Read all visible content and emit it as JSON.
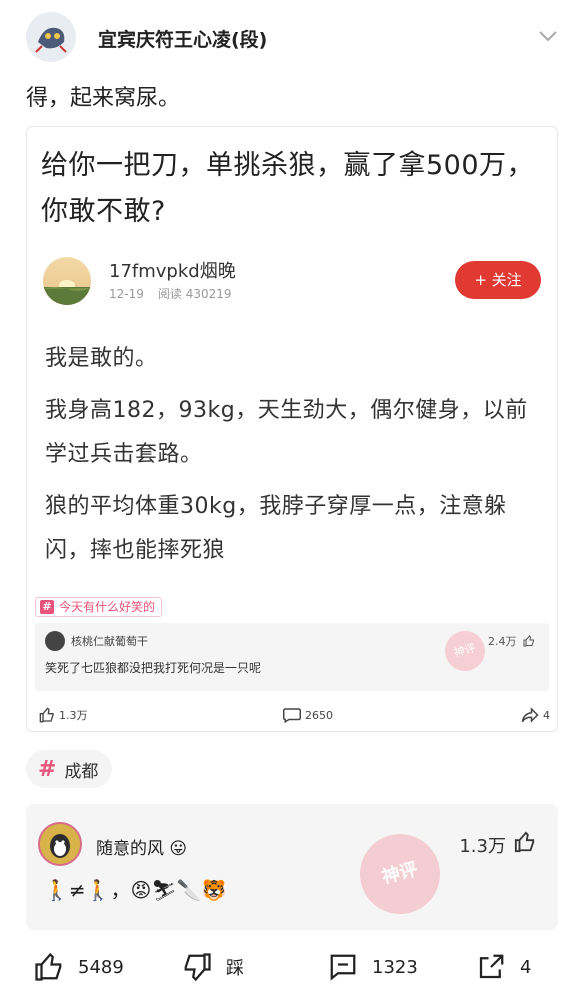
{
  "header": {
    "author": "宜宾庆符王心凌(段)"
  },
  "post": {
    "text": "得，起来窝尿。"
  },
  "card": {
    "title": "给你一把刀，单挑杀狼，赢了拿500万，你敢不敢?",
    "user": {
      "name": "17fmvpkd烟晚",
      "date": "12-19",
      "reads_label": "阅读 430219"
    },
    "follow_label": "+ 关注",
    "paragraphs": [
      "我是敢的。",
      "我身高182，93kg，天生劲大，偶尔健身，以前学过兵击套路。",
      "狼的平均体重30kg，我脖子穿厚一点，注意躲闪，摔也能摔死狼"
    ],
    "topic_label": "今天有什么好笑的",
    "mini_comment": {
      "name": "核桃仁献葡萄干",
      "likes": "2.4万",
      "text": "笑死了七匹狼都没把我打死何况是一只呢",
      "stamp": "神评"
    },
    "actions": {
      "likes": "1.3万",
      "comments": "2650",
      "shares": "4"
    }
  },
  "topic": {
    "label": "成都"
  },
  "comment": {
    "name": "随意的风",
    "likes": "1.3万",
    "text": "🚶≠🚶，😡⛷🔪🐯",
    "stamp": "神评"
  },
  "bottom_bar": {
    "likes": "5489",
    "dislike": "踩",
    "comments": "1323",
    "shares": "4"
  },
  "colors": {
    "accent": "#e03a33",
    "topic": "#e8547b",
    "stamp": "#f4c7cd"
  }
}
